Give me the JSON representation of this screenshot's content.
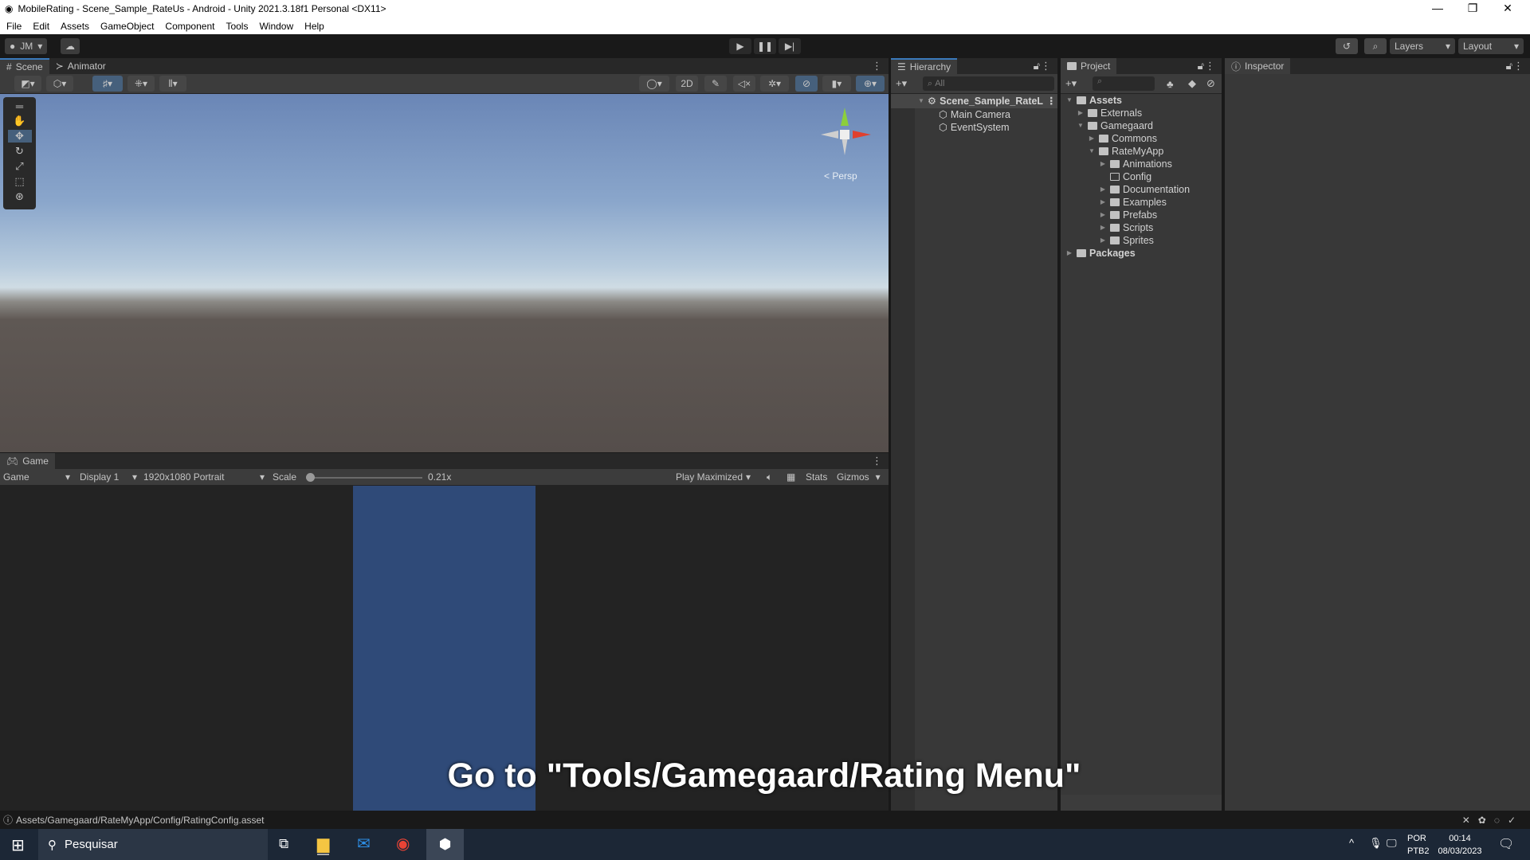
{
  "window": {
    "title": "MobileRating - Scene_Sample_RateUs - Android - Unity 2021.3.18f1 Personal <DX11>",
    "controls": [
      "—",
      "❐",
      "✕"
    ]
  },
  "menu": [
    "File",
    "Edit",
    "Assets",
    "GameObject",
    "Component",
    "Tools",
    "Window",
    "Help"
  ],
  "toolbar": {
    "account": "JM",
    "layers": "Layers",
    "layout": "Layout"
  },
  "scene": {
    "tabs": [
      "Scene",
      "Animator"
    ],
    "btn_2d": "2D",
    "persp": "< Persp"
  },
  "game": {
    "tab": "Game",
    "view": "Game",
    "display": "Display 1",
    "resolution": "1920x1080 Portrait",
    "scale_label": "Scale",
    "scale_value": "0.21x",
    "scale_fraction": 0.0,
    "play_mode": "Play Maximized",
    "stats": "Stats",
    "gizmos": "Gizmos",
    "canvas_color": "#2f4a78"
  },
  "hierarchy": {
    "title": "Hierarchy",
    "search_placeholder": "All",
    "scene": "Scene_Sample_RateL",
    "items": [
      "Main Camera",
      "EventSystem"
    ]
  },
  "project": {
    "title": "Project",
    "tree": [
      {
        "label": "Assets",
        "depth": 0,
        "open": true,
        "bold": true
      },
      {
        "label": "Externals",
        "depth": 1,
        "open": false
      },
      {
        "label": "Gamegaard",
        "depth": 1,
        "open": true
      },
      {
        "label": "Commons",
        "depth": 2,
        "open": false
      },
      {
        "label": "RateMyApp",
        "depth": 2,
        "open": true
      },
      {
        "label": "Animations",
        "depth": 3,
        "open": false
      },
      {
        "label": "Config",
        "depth": 3,
        "leaf": true
      },
      {
        "label": "Documentation",
        "depth": 3,
        "open": false
      },
      {
        "label": "Examples",
        "depth": 3,
        "open": false
      },
      {
        "label": "Prefabs",
        "depth": 3,
        "open": false
      },
      {
        "label": "Scripts",
        "depth": 3,
        "open": false
      },
      {
        "label": "Sprites",
        "depth": 3,
        "open": false
      },
      {
        "label": "Packages",
        "depth": 0,
        "open": false,
        "bold": true
      }
    ]
  },
  "inspector": {
    "title": "Inspector"
  },
  "status": {
    "path": "Assets/Gamegaard/RateMyApp/Config/RatingConfig.asset"
  },
  "caption": "Go to \"Tools/Gamegaard/Rating Menu\"",
  "taskbar": {
    "search": "Pesquisar",
    "lang": "POR",
    "layout": "PTB2",
    "time": "00:14",
    "date": "08/03/2023"
  }
}
